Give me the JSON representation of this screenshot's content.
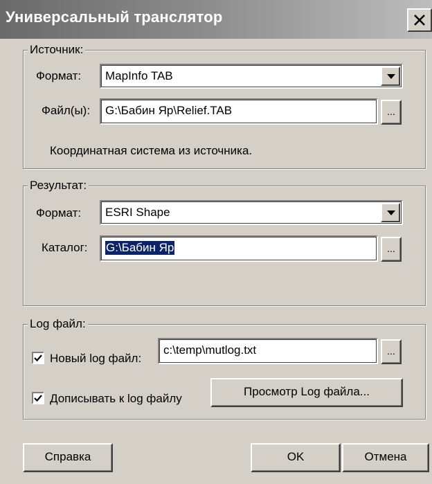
{
  "window": {
    "title": "Универсальный транслятор"
  },
  "source": {
    "legend": "Источник:",
    "format_label": "Формат:",
    "format_value": "MapInfo TAB",
    "files_label": "Файл(ы):",
    "files_value": "G:\\Бабин Яр\\Relief.TAB",
    "browse_label": "...",
    "coord_note": "Координатная система из источника."
  },
  "result": {
    "legend": "Результат:",
    "format_label": "Формат:",
    "format_value": "ESRI Shape",
    "catalog_label": "Каталог:",
    "catalog_value": "G:\\Бабин Яр",
    "browse_label": "..."
  },
  "log": {
    "legend": "Log файл:",
    "new_log_label": "Новый log файл:",
    "new_log_checked": true,
    "log_path": "c:\\temp\\mutlog.txt",
    "browse_label": "...",
    "append_label": "Дописывать к log файлу",
    "append_checked": true,
    "view_button": "Просмотр Log файла..."
  },
  "footer": {
    "help_button": "Справка",
    "ok_button": "OK",
    "cancel_button": "Отмена"
  }
}
